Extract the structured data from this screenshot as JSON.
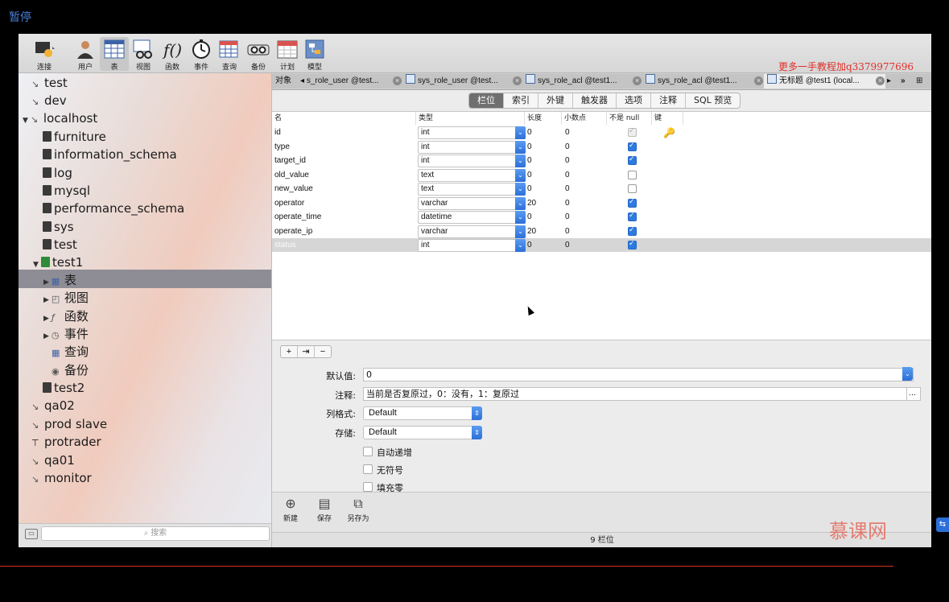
{
  "overlay": {
    "pause_label": "暂停",
    "watermark_top": "更多一手教程加q3379977696",
    "watermark_logo": "慕课网"
  },
  "toolbar": {
    "items": [
      {
        "label": "连接"
      },
      {
        "label": "用户"
      },
      {
        "label": "表"
      },
      {
        "label": "视图"
      },
      {
        "label": "函数"
      },
      {
        "label": "事件"
      },
      {
        "label": "查询"
      },
      {
        "label": "备份"
      },
      {
        "label": "计划"
      },
      {
        "label": "模型"
      }
    ],
    "selected": "表"
  },
  "sidebar": {
    "items": [
      {
        "label": "test"
      },
      {
        "label": "dev"
      },
      {
        "label": "localhost"
      },
      {
        "label": "furniture"
      },
      {
        "label": "information_schema"
      },
      {
        "label": "log"
      },
      {
        "label": "mysql"
      },
      {
        "label": "performance_schema"
      },
      {
        "label": "sys"
      },
      {
        "label": "test"
      },
      {
        "label": "test1"
      },
      {
        "label": "表"
      },
      {
        "label": "视图"
      },
      {
        "label": "函数"
      },
      {
        "label": "事件"
      },
      {
        "label": "查询"
      },
      {
        "label": "备份"
      },
      {
        "label": "test2"
      },
      {
        "label": "qa02"
      },
      {
        "label": "prod slave"
      },
      {
        "label": "protrader"
      },
      {
        "label": "qa01"
      },
      {
        "label": "monitor"
      }
    ],
    "search_placeholder": "搜索"
  },
  "tabs": [
    {
      "label": "对象"
    },
    {
      "label": "s_role_user @test..."
    },
    {
      "label": "sys_role_user @test..."
    },
    {
      "label": "sys_role_acl @test1..."
    },
    {
      "label": "sys_role_acl @test1..."
    },
    {
      "label": "无标题 @test1 (local..."
    }
  ],
  "segments": [
    "栏位",
    "索引",
    "外键",
    "触发器",
    "选项",
    "注释",
    "SQL 预览"
  ],
  "grid": {
    "headers": [
      "名",
      "类型",
      "长度",
      "小数点",
      "不是 null",
      "键"
    ],
    "rows": [
      {
        "name": "id",
        "type": "int",
        "length": "0",
        "decimals": "0",
        "not_null": "dim",
        "key": true
      },
      {
        "name": "type",
        "type": "int",
        "length": "0",
        "decimals": "0",
        "not_null": "on",
        "key": false
      },
      {
        "name": "target_id",
        "type": "int",
        "length": "0",
        "decimals": "0",
        "not_null": "on",
        "key": false
      },
      {
        "name": "old_value",
        "type": "text",
        "length": "0",
        "decimals": "0",
        "not_null": "off",
        "key": false
      },
      {
        "name": "new_value",
        "type": "text",
        "length": "0",
        "decimals": "0",
        "not_null": "off",
        "key": false
      },
      {
        "name": "operator",
        "type": "varchar",
        "length": "20",
        "decimals": "0",
        "not_null": "on",
        "key": false
      },
      {
        "name": "operate_time",
        "type": "datetime",
        "length": "0",
        "decimals": "0",
        "not_null": "on",
        "key": false
      },
      {
        "name": "operate_ip",
        "type": "varchar",
        "length": "20",
        "decimals": "0",
        "not_null": "on",
        "key": false
      },
      {
        "name": "status",
        "type": "int",
        "length": "0",
        "decimals": "0",
        "not_null": "on",
        "key": false
      }
    ]
  },
  "form": {
    "default_label": "默认值:",
    "default_value": "0",
    "comment_label": "注释:",
    "comment_value": "当前是否复原过，0：没有，1：复原过",
    "colformat_label": "列格式:",
    "colformat_value": "Default",
    "storage_label": "存储:",
    "storage_value": "Default",
    "auto_inc": "自动递增",
    "unsigned": "无符号",
    "zerofill": "填充零"
  },
  "bottom": {
    "new": "新建",
    "save": "保存",
    "save_as": "另存为"
  },
  "status": {
    "text": "9 栏位"
  }
}
